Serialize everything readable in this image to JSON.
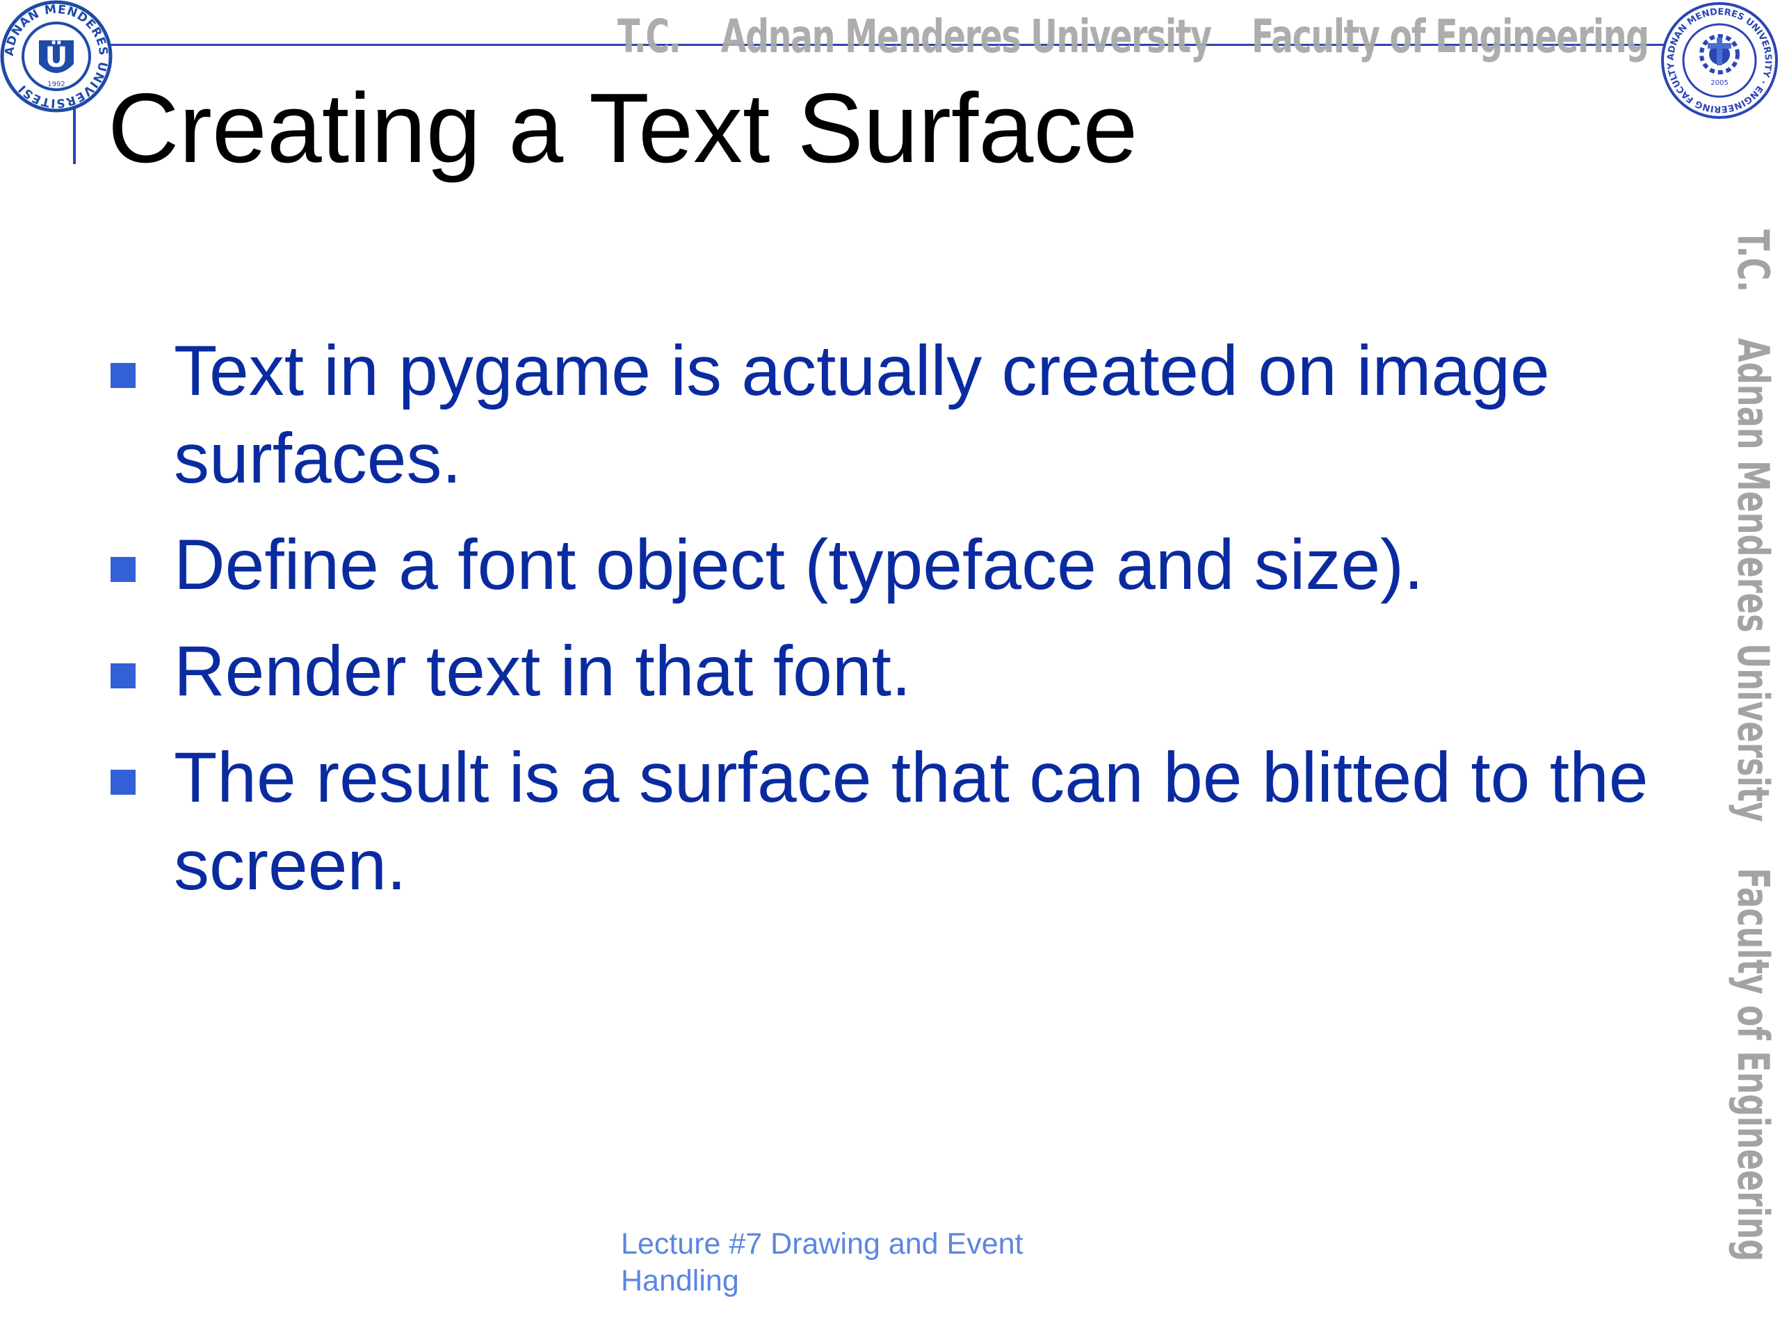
{
  "header": {
    "watermark": [
      "T.C.",
      "Adnan Menderes University",
      "Faculty of Engineering"
    ],
    "left_logo": {
      "ring_text": "ADNAN MENDERES ÜNİVERSİTESİ",
      "year": "1992",
      "monogram": "Ü",
      "color": "#1e4aa8"
    },
    "right_logo": {
      "ring_text": "ADNAN MENDERES UNIVERSITY · ENGINEERING FACULTY",
      "year": "2005",
      "color": "#2b45b5"
    },
    "line_color": "#2b45b5"
  },
  "side_watermark": [
    "T.C.",
    "Adnan Menderes University",
    "Faculty of Engineering"
  ],
  "slide": {
    "title": "Creating a Text Surface",
    "bullets": [
      "Text in pygame is actually created on image surfaces.",
      "Define a font object (typeface and size).",
      "Render text in that font.",
      "The result is a surface that can be blitted to the screen."
    ],
    "text_color": "#0a2ba0",
    "bullet_color": "#3360d6"
  },
  "footer": {
    "line1": "Lecture #7 Drawing and Event",
    "line2": "Handling"
  }
}
